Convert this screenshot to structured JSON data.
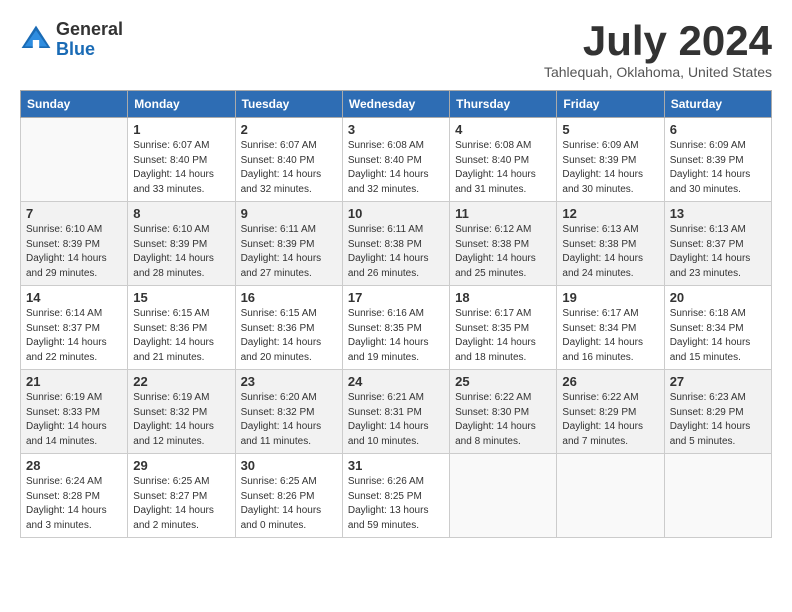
{
  "header": {
    "logo": {
      "general": "General",
      "blue": "Blue"
    },
    "month_title": "July 2024",
    "location": "Tahlequah, Oklahoma, United States"
  },
  "days_of_week": [
    "Sunday",
    "Monday",
    "Tuesday",
    "Wednesday",
    "Thursday",
    "Friday",
    "Saturday"
  ],
  "weeks": [
    [
      {
        "day": "",
        "info": ""
      },
      {
        "day": "1",
        "info": "Sunrise: 6:07 AM\nSunset: 8:40 PM\nDaylight: 14 hours\nand 33 minutes."
      },
      {
        "day": "2",
        "info": "Sunrise: 6:07 AM\nSunset: 8:40 PM\nDaylight: 14 hours\nand 32 minutes."
      },
      {
        "day": "3",
        "info": "Sunrise: 6:08 AM\nSunset: 8:40 PM\nDaylight: 14 hours\nand 32 minutes."
      },
      {
        "day": "4",
        "info": "Sunrise: 6:08 AM\nSunset: 8:40 PM\nDaylight: 14 hours\nand 31 minutes."
      },
      {
        "day": "5",
        "info": "Sunrise: 6:09 AM\nSunset: 8:39 PM\nDaylight: 14 hours\nand 30 minutes."
      },
      {
        "day": "6",
        "info": "Sunrise: 6:09 AM\nSunset: 8:39 PM\nDaylight: 14 hours\nand 30 minutes."
      }
    ],
    [
      {
        "day": "7",
        "info": "Sunrise: 6:10 AM\nSunset: 8:39 PM\nDaylight: 14 hours\nand 29 minutes."
      },
      {
        "day": "8",
        "info": "Sunrise: 6:10 AM\nSunset: 8:39 PM\nDaylight: 14 hours\nand 28 minutes."
      },
      {
        "day": "9",
        "info": "Sunrise: 6:11 AM\nSunset: 8:39 PM\nDaylight: 14 hours\nand 27 minutes."
      },
      {
        "day": "10",
        "info": "Sunrise: 6:11 AM\nSunset: 8:38 PM\nDaylight: 14 hours\nand 26 minutes."
      },
      {
        "day": "11",
        "info": "Sunrise: 6:12 AM\nSunset: 8:38 PM\nDaylight: 14 hours\nand 25 minutes."
      },
      {
        "day": "12",
        "info": "Sunrise: 6:13 AM\nSunset: 8:38 PM\nDaylight: 14 hours\nand 24 minutes."
      },
      {
        "day": "13",
        "info": "Sunrise: 6:13 AM\nSunset: 8:37 PM\nDaylight: 14 hours\nand 23 minutes."
      }
    ],
    [
      {
        "day": "14",
        "info": "Sunrise: 6:14 AM\nSunset: 8:37 PM\nDaylight: 14 hours\nand 22 minutes."
      },
      {
        "day": "15",
        "info": "Sunrise: 6:15 AM\nSunset: 8:36 PM\nDaylight: 14 hours\nand 21 minutes."
      },
      {
        "day": "16",
        "info": "Sunrise: 6:15 AM\nSunset: 8:36 PM\nDaylight: 14 hours\nand 20 minutes."
      },
      {
        "day": "17",
        "info": "Sunrise: 6:16 AM\nSunset: 8:35 PM\nDaylight: 14 hours\nand 19 minutes."
      },
      {
        "day": "18",
        "info": "Sunrise: 6:17 AM\nSunset: 8:35 PM\nDaylight: 14 hours\nand 18 minutes."
      },
      {
        "day": "19",
        "info": "Sunrise: 6:17 AM\nSunset: 8:34 PM\nDaylight: 14 hours\nand 16 minutes."
      },
      {
        "day": "20",
        "info": "Sunrise: 6:18 AM\nSunset: 8:34 PM\nDaylight: 14 hours\nand 15 minutes."
      }
    ],
    [
      {
        "day": "21",
        "info": "Sunrise: 6:19 AM\nSunset: 8:33 PM\nDaylight: 14 hours\nand 14 minutes."
      },
      {
        "day": "22",
        "info": "Sunrise: 6:19 AM\nSunset: 8:32 PM\nDaylight: 14 hours\nand 12 minutes."
      },
      {
        "day": "23",
        "info": "Sunrise: 6:20 AM\nSunset: 8:32 PM\nDaylight: 14 hours\nand 11 minutes."
      },
      {
        "day": "24",
        "info": "Sunrise: 6:21 AM\nSunset: 8:31 PM\nDaylight: 14 hours\nand 10 minutes."
      },
      {
        "day": "25",
        "info": "Sunrise: 6:22 AM\nSunset: 8:30 PM\nDaylight: 14 hours\nand 8 minutes."
      },
      {
        "day": "26",
        "info": "Sunrise: 6:22 AM\nSunset: 8:29 PM\nDaylight: 14 hours\nand 7 minutes."
      },
      {
        "day": "27",
        "info": "Sunrise: 6:23 AM\nSunset: 8:29 PM\nDaylight: 14 hours\nand 5 minutes."
      }
    ],
    [
      {
        "day": "28",
        "info": "Sunrise: 6:24 AM\nSunset: 8:28 PM\nDaylight: 14 hours\nand 3 minutes."
      },
      {
        "day": "29",
        "info": "Sunrise: 6:25 AM\nSunset: 8:27 PM\nDaylight: 14 hours\nand 2 minutes."
      },
      {
        "day": "30",
        "info": "Sunrise: 6:25 AM\nSunset: 8:26 PM\nDaylight: 14 hours\nand 0 minutes."
      },
      {
        "day": "31",
        "info": "Sunrise: 6:26 AM\nSunset: 8:25 PM\nDaylight: 13 hours\nand 59 minutes."
      },
      {
        "day": "",
        "info": ""
      },
      {
        "day": "",
        "info": ""
      },
      {
        "day": "",
        "info": ""
      }
    ]
  ]
}
